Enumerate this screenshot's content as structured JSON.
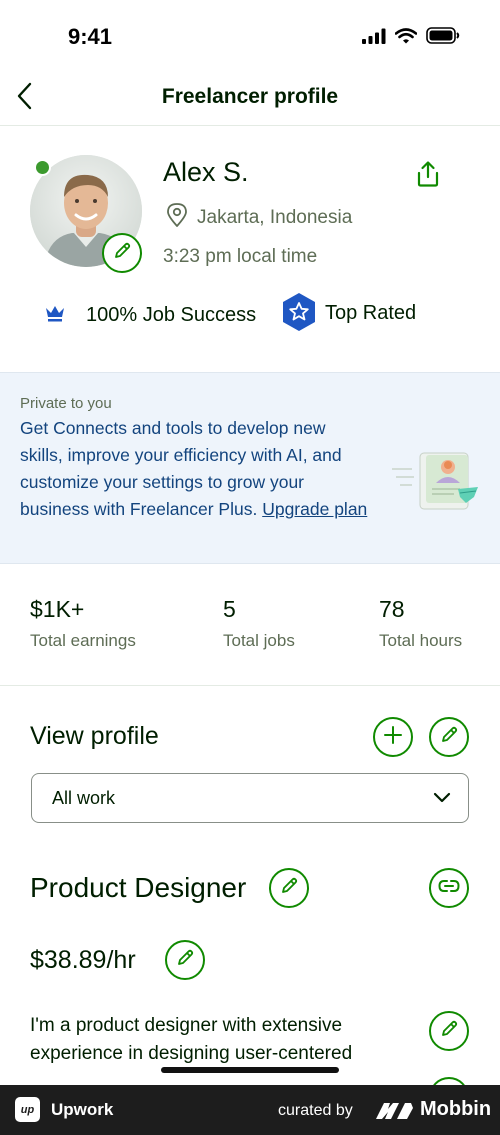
{
  "status_bar": {
    "time": "9:41",
    "icons": [
      "cellular-signal-icon",
      "wifi-icon",
      "battery-icon"
    ]
  },
  "nav": {
    "title": "Freelancer profile",
    "back_icon": "chevron-left-icon"
  },
  "profile": {
    "name": "Alex S.",
    "location": "Jakarta, Indonesia",
    "local_time": "3:23 pm local time",
    "online": true,
    "job_success": "100% Job Success",
    "top_rated": "Top Rated"
  },
  "promo": {
    "eyebrow": "Private to you",
    "body": "Get Connects and tools to develop new skills, improve your efficiency with AI, and customize your settings to grow your business with Freelancer Plus. ",
    "link": "Upgrade plan"
  },
  "stats": [
    {
      "value": "$1K+",
      "label": "Total earnings"
    },
    {
      "value": "5",
      "label": "Total jobs"
    },
    {
      "value": "78",
      "label": "Total hours"
    }
  ],
  "view_profile": {
    "title": "View profile",
    "select_value": "All work"
  },
  "job": {
    "title": "Product Designer",
    "rate": "$38.89/hr",
    "overview": "I'm a product designer with extensive experience in designing user-centered"
  },
  "footer": {
    "app_name": "Upwork",
    "logo_text": "up",
    "curated_by": "curated by",
    "brand": "Mobbin"
  },
  "colors": {
    "brand_green": "#108a00",
    "online_green": "#3c9a2e",
    "promo_bg": "#eef4fb",
    "promo_text": "#13447e",
    "top_rated_blue": "#1f57c3",
    "footer_bg": "#1d1d1d"
  }
}
